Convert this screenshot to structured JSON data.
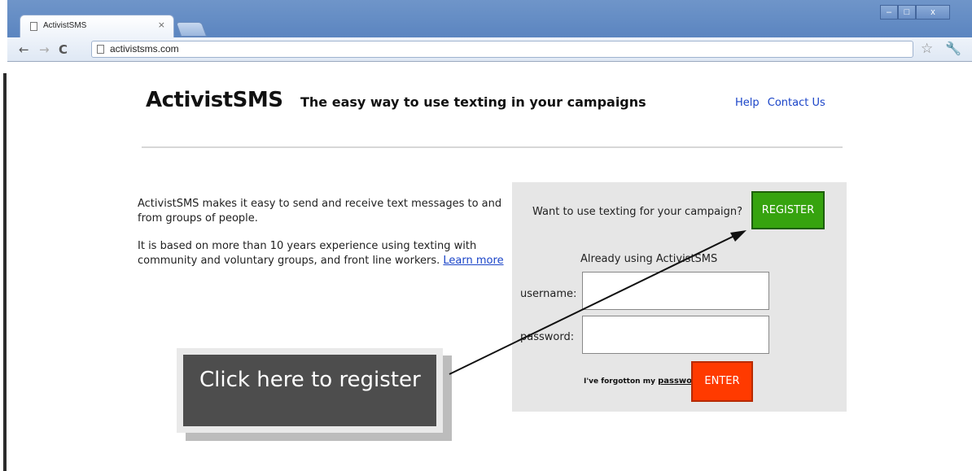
{
  "browser": {
    "tab_title": "ActivistSMS",
    "tab_close": "×",
    "url": "activistsms.com",
    "window_controls": {
      "minimize": "–",
      "maximize": "□",
      "close": "x"
    }
  },
  "header": {
    "brand": "ActivistSMS",
    "tagline": "The easy way to use texting in your campaigns",
    "links": [
      "Help",
      "Contact Us"
    ]
  },
  "intro": {
    "paragraph1": "ActivistSMS makes it easy to send and receive text messages to and from groups of people.",
    "paragraph2": "It is based on more than 10 years experience using texting with community and voluntary groups, and front line workers.",
    "learn_more": "Learn more"
  },
  "login_panel": {
    "want_text": "Want to use texting for your campaign?",
    "register_label": "REGISTER",
    "already_text": "Already using ActivistSMS",
    "username_label": "username:",
    "password_label": "password:",
    "forgot_prefix": "I've forgotton my",
    "forgot_link": "password",
    "enter_label": "ENTER"
  },
  "callout": {
    "text": "Click here to register"
  },
  "colors": {
    "register": "#36a30f",
    "enter": "#ff3a00",
    "link": "#1a44c8",
    "callout_bg": "#4d4d4d",
    "panel_bg": "#e6e6e6"
  }
}
